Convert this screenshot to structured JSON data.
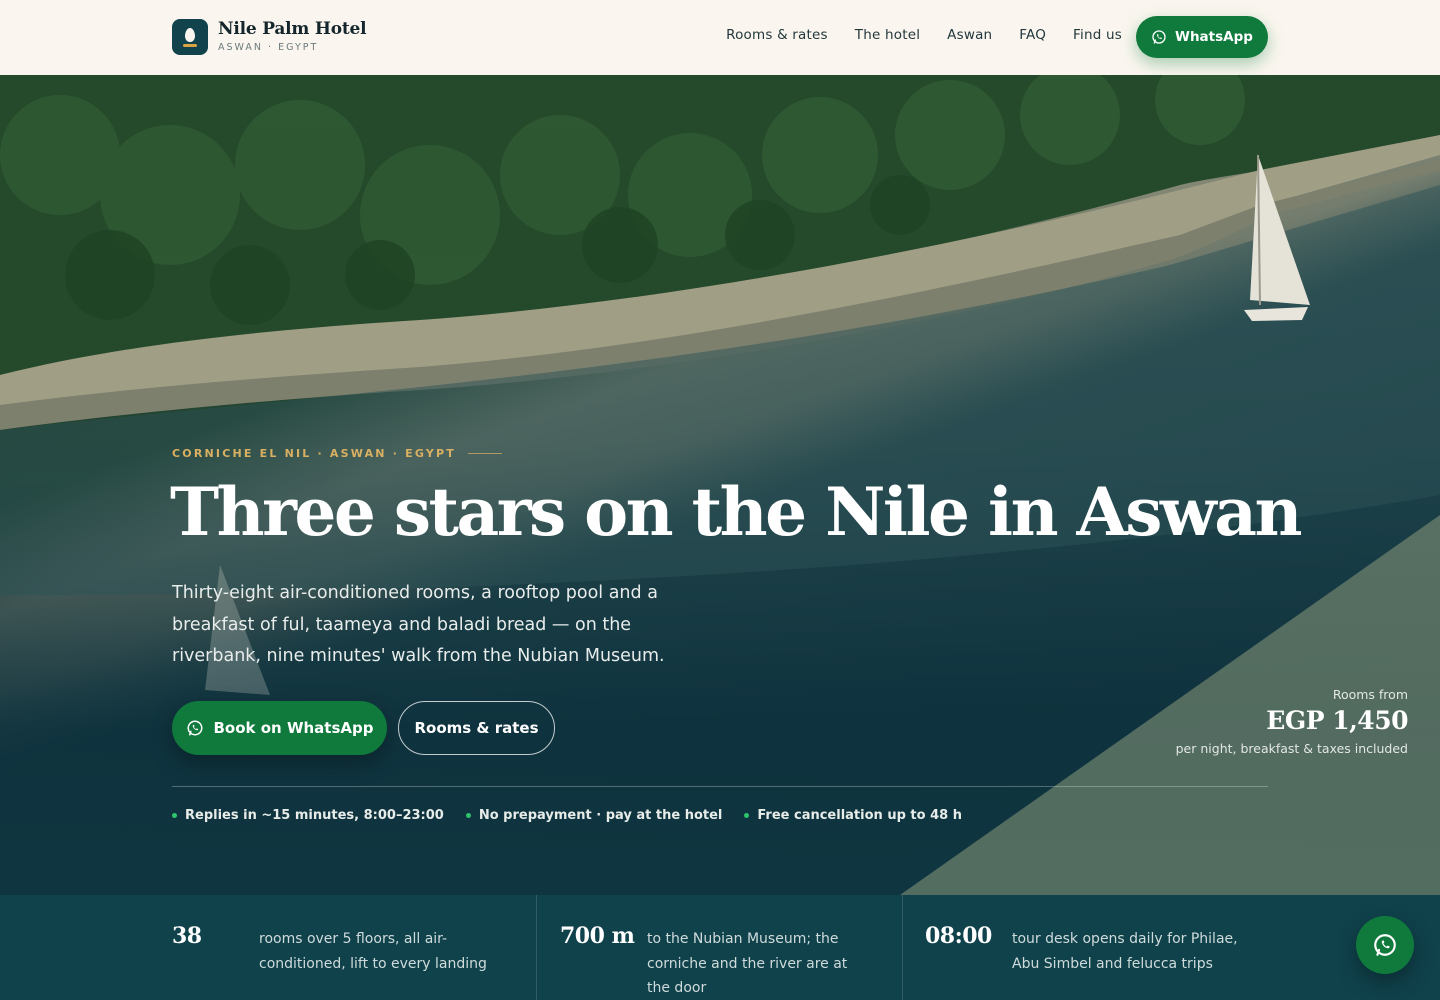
{
  "brand": {
    "name": "Nile Palm Hotel",
    "sub": "ASWAN · EGYPT"
  },
  "nav": [
    "Rooms & rates",
    "The hotel",
    "Aswan",
    "FAQ",
    "Find us"
  ],
  "header_cta": "WhatsApp",
  "hero": {
    "eyebrow": "CORNICHE EL NIL · ASWAN · EGYPT",
    "title": "Three stars on the Nile in Aswan",
    "lede": "Thirty-eight air-conditioned rooms, a rooftop pool and a breakfast of ful, taameya and baladi bread — on the riverbank, nine minutes' walk from the Nubian Museum.",
    "primary_cta": "Book on WhatsApp",
    "secondary_cta": "Rooms & rates"
  },
  "price": {
    "label": "Rooms from",
    "value": "EGP 1,450",
    "note": "per night, breakfast & taxes included"
  },
  "assurances": [
    "Replies in ~15 minutes, 8:00–23:00",
    "No prepayment · pay at the hotel",
    "Free cancellation up to 48 h"
  ],
  "stats": [
    {
      "num": "38",
      "desc": "rooms over 5 floors, all air-conditioned, lift to every landing"
    },
    {
      "num": "700 m",
      "desc": "to the Nubian Museum; the corniche and the river are at the door"
    },
    {
      "num": "08:00",
      "desc": "tour desk opens daily for Philae, Abu Simbel and felucca trips"
    }
  ],
  "colors": {
    "accent": "#0f7a3c",
    "gold": "#d9b062",
    "deep": "#10424c",
    "cream": "#faf6ef"
  },
  "icons": {
    "whatsapp": "whatsapp-icon",
    "logo": "drop-logo-icon"
  }
}
